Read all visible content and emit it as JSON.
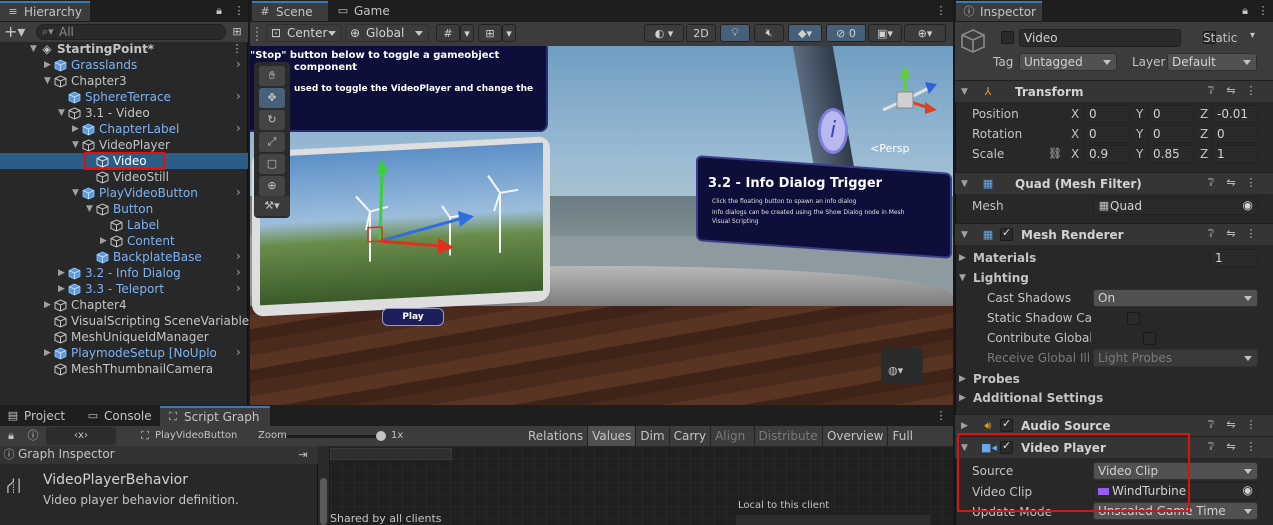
{
  "hierarchy": {
    "tab_label": "Hierarchy",
    "search_placeholder": "All",
    "items": [
      {
        "label": "StartingPoint*"
      },
      {
        "label": "Grasslands"
      },
      {
        "label": "Chapter3"
      },
      {
        "label": "SphereTerrace"
      },
      {
        "label": "3.1 - Video"
      },
      {
        "label": "ChapterLabel"
      },
      {
        "label": "VideoPlayer"
      },
      {
        "label": "Video"
      },
      {
        "label": "VideoStill"
      },
      {
        "label": "PlayVideoButton"
      },
      {
        "label": "Button"
      },
      {
        "label": "Label"
      },
      {
        "label": "Content"
      },
      {
        "label": "BackplateBase"
      },
      {
        "label": "3.2 - Info Dialog"
      },
      {
        "label": "3.3 - Teleport"
      },
      {
        "label": "Chapter4"
      },
      {
        "label": "VisualScripting SceneVariables"
      },
      {
        "label": "MeshUniqueIdManager"
      },
      {
        "label": "PlaymodeSetup [NoUpload]"
      },
      {
        "label": "MeshThumbnailCamera"
      }
    ]
  },
  "scene": {
    "tabs": [
      {
        "label": "Scene"
      },
      {
        "label": "Game"
      }
    ],
    "pivot_label": "Center",
    "space_label": "Global",
    "mode_2d": "2D",
    "persp_label": "<Persp",
    "panel_text_1": "\"Stop\" button below to toggle a gameobject",
    "panel_text_2": "component",
    "panel_text_3": "used to toggle the VideoPlayer and change the",
    "play_label": "Play",
    "info_title": "3.2 - Info Dialog Trigger",
    "info_line_1": "Click the floating button to spawn an info dialog",
    "info_line_2": "Info dialogs can be created using the Show Dialog  node in Mesh",
    "info_line_3": "Visual Scripting"
  },
  "bottom": {
    "tabs": [
      {
        "label": "Project"
      },
      {
        "label": "Console"
      },
      {
        "label": "Script Graph"
      }
    ],
    "breadcrumb": "PlayVideoButton",
    "zoom_label": "Zoom",
    "zoom_value": "1x",
    "zoom_level": 1.0,
    "toolbar": [
      {
        "label": "Relations"
      },
      {
        "label": "Values"
      },
      {
        "label": "Dim"
      },
      {
        "label": "Carry"
      },
      {
        "label": "Align"
      },
      {
        "label": "Distribute"
      },
      {
        "label": "Overview"
      },
      {
        "label": "Full Screen"
      }
    ],
    "graph_inspector_label": "Graph Inspector",
    "behavior_title": "VideoPlayerBehavior",
    "behavior_desc": "Video player behavior definition.",
    "shared_label": "Shared by all clients",
    "local_label": "Local to this client"
  },
  "inspector": {
    "tab_label": "Inspector",
    "object_name": "Video",
    "static_label": "Static",
    "tag_label": "Tag",
    "tag_value": "Untagged",
    "layer_label": "Layer",
    "layer_value": "Default",
    "transform": {
      "title": "Transform",
      "position_label": "Position",
      "rotation_label": "Rotation",
      "scale_label": "Scale",
      "position": {
        "x": "0",
        "y": "0",
        "z": "-0.01"
      },
      "rotation": {
        "x": "0",
        "y": "0",
        "z": "0"
      },
      "scale": {
        "x": "0.9",
        "y": "0.85",
        "z": "1"
      }
    },
    "mesh_filter": {
      "title": "Quad (Mesh Filter)",
      "mesh_label": "Mesh",
      "mesh_value": "Quad"
    },
    "mesh_renderer": {
      "title": "Mesh Renderer",
      "materials_label": "Materials",
      "materials_count": "1",
      "lighting_label": "Lighting",
      "cast_shadows_label": "Cast Shadows",
      "cast_shadows_value": "On",
      "static_shadow_label": "Static Shadow Cas",
      "contribute_gi_label": "Contribute Global I",
      "receive_gi_label": "Receive Global Illu",
      "receive_gi_value": "Light Probes",
      "probes_label": "Probes",
      "additional_label": "Additional Settings"
    },
    "audio_source": {
      "title": "Audio Source"
    },
    "video_player": {
      "title": "Video Player",
      "source_label": "Source",
      "source_value": "Video Clip",
      "clip_label": "Video Clip",
      "clip_value": "WindTurbine",
      "update_label": "Update Mode",
      "update_value": "Unscaled Game Time"
    }
  },
  "colors": {
    "accent_selection": "#2c5d87",
    "highlight_red": "#e01010",
    "prefab_blue": "#7bb4f7"
  }
}
